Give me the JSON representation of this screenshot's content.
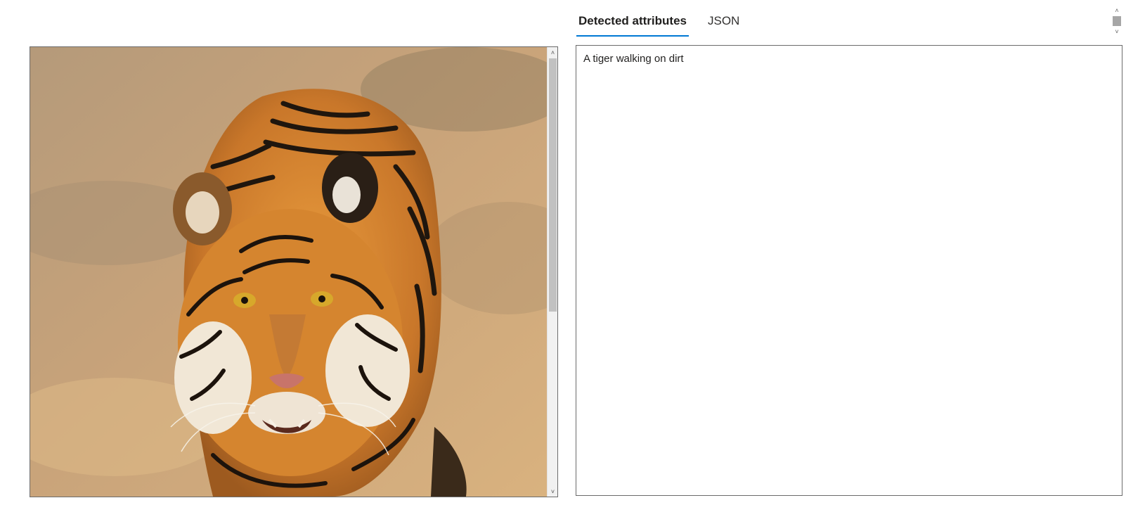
{
  "tabs": [
    {
      "label": "Detected attributes",
      "active": true
    },
    {
      "label": "JSON",
      "active": false
    }
  ],
  "image": {
    "alt": "",
    "scrollbar": {
      "up_glyph": "˄",
      "down_glyph": "˅"
    }
  },
  "page_scrollbar": {
    "up_glyph": "˄",
    "down_glyph": "˅"
  },
  "attributes": {
    "caption": "A tiger walking on dirt"
  },
  "colors": {
    "accent": "#0078d4",
    "border": "#6b6b6b"
  }
}
